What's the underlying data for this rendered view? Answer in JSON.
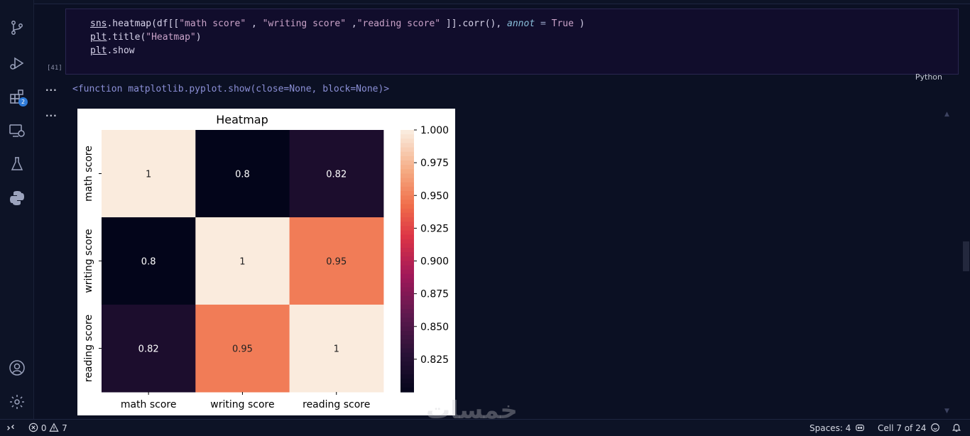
{
  "code": {
    "line1": {
      "mod": "sns",
      "call": ".heatmap(df[[",
      "s1": "\"math score\"",
      "c1": " , ",
      "s2": "\"writing score\"",
      "c2": " ,",
      "s3": "\"reading score\"",
      "c3": " ]].corr(), ",
      "kw": "annot",
      "eq": " = ",
      "val": "True",
      "end": " )"
    },
    "line2": {
      "mod": "plt",
      "call": ".title(",
      "s": "\"Heatmap\"",
      "end": ")"
    },
    "line3": {
      "mod": "plt",
      "call": ".show"
    },
    "exec_count": "[41]",
    "language": "Python"
  },
  "output_text": "<function matplotlib.pyplot.show(close=None, block=None)>",
  "cell_menu": "...",
  "activity": {
    "extensions_badge": "2"
  },
  "status": {
    "errors": "0",
    "warnings": "7",
    "spaces": "Spaces: 4",
    "cell": "Cell 7 of 24"
  },
  "watermark": "خمسات",
  "chart_data": {
    "type": "heatmap",
    "title": "Heatmap",
    "rows": [
      "math score",
      "writing score",
      "reading score"
    ],
    "cols": [
      "math score",
      "writing score",
      "reading score"
    ],
    "values": [
      [
        1,
        0.8,
        0.82
      ],
      [
        0.8,
        1,
        0.95
      ],
      [
        0.82,
        0.95,
        1
      ]
    ],
    "annotations": [
      [
        "1",
        "0.8",
        "0.82"
      ],
      [
        "0.8",
        "1",
        "0.95"
      ],
      [
        "0.82",
        "0.95",
        "1"
      ]
    ],
    "colorbar": {
      "min": 0.8,
      "max": 1.0,
      "ticks": [
        "1.000",
        "0.975",
        "0.950",
        "0.925",
        "0.900",
        "0.875",
        "0.850",
        "0.825"
      ],
      "tick_values": [
        1.0,
        0.975,
        0.95,
        0.925,
        0.9,
        0.875,
        0.85,
        0.825
      ]
    },
    "colormap": "rocket",
    "colors": {
      "high": "#faebdd",
      "low": "#03051a"
    }
  }
}
